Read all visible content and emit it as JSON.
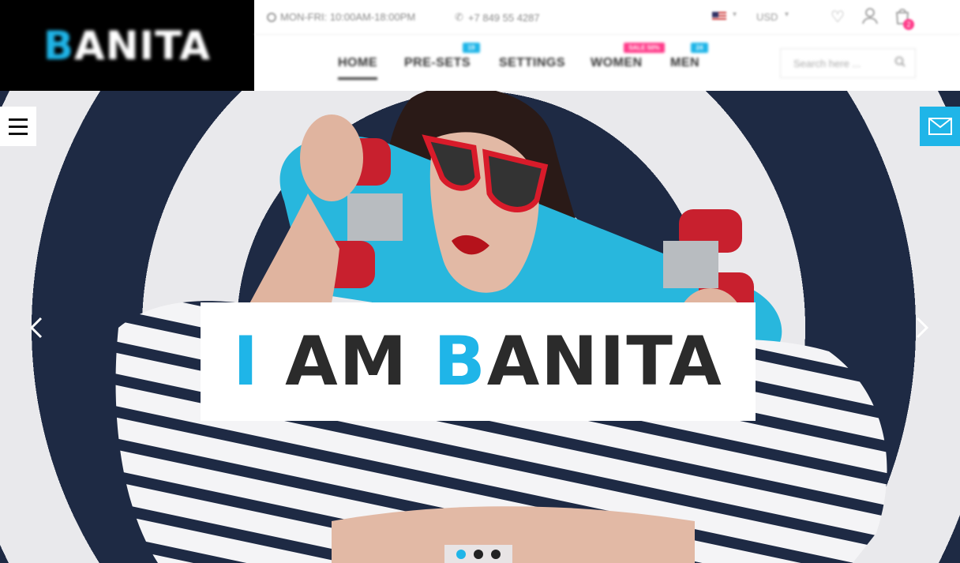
{
  "brand": {
    "logo_first": "B",
    "logo_rest": "ANITA",
    "accent_color": "#1fb5e8",
    "pink_color": "#ff3c8a"
  },
  "topbar": {
    "hours": "MON-FRI: 10:00AM-18:00PM",
    "phone": "+7 849 55 4287",
    "language_icon": "us-flag-icon",
    "currency": "USD",
    "cart_count": "2"
  },
  "nav": {
    "items": [
      {
        "label": "HOME",
        "active": true
      },
      {
        "label": "PRE-SETS",
        "badge": "19"
      },
      {
        "label": "SETTINGS"
      },
      {
        "label": "WOMEN",
        "badge": "SALE 50%"
      },
      {
        "label": "MEN",
        "badge": "24"
      }
    ],
    "search_placeholder": "Search here ..."
  },
  "hero": {
    "title_i": "I",
    "title_am": " AM ",
    "title_b": "B",
    "title_rest": "ANITA",
    "slides": 3,
    "active_slide": 1
  }
}
